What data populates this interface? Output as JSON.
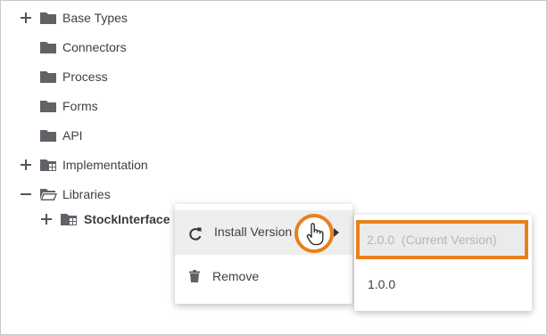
{
  "tree": {
    "items": [
      {
        "label": "Base Types",
        "toggle": "plus",
        "folder": "closed"
      },
      {
        "label": "Connectors",
        "toggle": "",
        "folder": "closed"
      },
      {
        "label": "Process",
        "toggle": "",
        "folder": "closed"
      },
      {
        "label": "Forms",
        "toggle": "",
        "folder": "closed"
      },
      {
        "label": "API",
        "toggle": "",
        "folder": "closed"
      },
      {
        "label": "Implementation",
        "toggle": "plus",
        "folder": "grid"
      },
      {
        "label": "Libraries",
        "toggle": "minus",
        "folder": "open"
      },
      {
        "label": "StockInterface",
        "toggle": "plus",
        "folder": "grid"
      }
    ]
  },
  "context_menu": {
    "install_version": "Install Version",
    "remove": "Remove"
  },
  "submenu": {
    "current_version": "2.0.0  (Current Version)",
    "other_version": "1.0.0"
  },
  "colors": {
    "icon": "#5f6368",
    "accent": "#e8801b",
    "disabled_text": "#b5b5b5"
  }
}
